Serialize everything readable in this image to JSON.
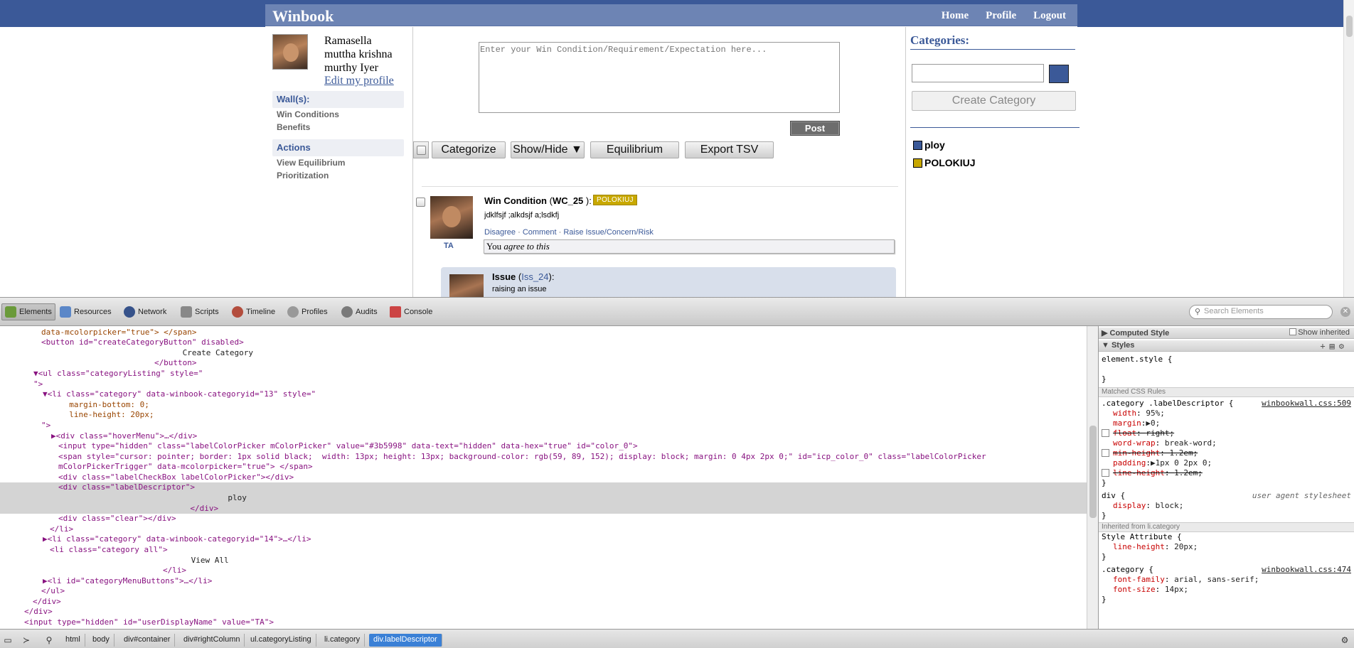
{
  "app": {
    "brand": "Winbook",
    "nav": [
      "Home",
      "Profile",
      "Logout"
    ]
  },
  "user": {
    "name": "Ramasella muttha krishna murthy Iyer",
    "edit_profile": "Edit my profile"
  },
  "left_menu": {
    "walls_header": "Wall(s):",
    "walls": [
      "Win Conditions",
      "Benefits"
    ],
    "actions_header": "Actions",
    "actions": [
      "View Equilibrium",
      "Prioritization"
    ]
  },
  "composer": {
    "placeholder": "Enter your Win Condition/Requirement/Expectation here...",
    "post_label": "Post"
  },
  "toolbar": {
    "buttons": [
      "Categorize",
      "Show/Hide ▼",
      "Equilibrium",
      "Export TSV"
    ]
  },
  "post": {
    "type": "Win Condition",
    "id": "WC_25",
    "badge": "POLOKIUJ",
    "badge_color": "#c8a800",
    "body": "jdklfsjf ;alkdsjf a;lsdkfj",
    "author": "TA",
    "actions": [
      "Disagree",
      "Comment",
      "Raise Issue/Concern/Risk"
    ],
    "agree_prefix": "You",
    "agree_text": "agree to this"
  },
  "issue": {
    "type": "Issue",
    "id": "Iss_24",
    "body": "raising an issue"
  },
  "categories": {
    "title": "Categories:",
    "create_label": "Create Category",
    "picker_color": "#3b5998",
    "items": [
      {
        "label": "ploy",
        "color": "#3b5998"
      },
      {
        "label": "POLOKIUJ",
        "color": "#c8a800"
      }
    ]
  },
  "devtools": {
    "tabs": [
      "Elements",
      "Resources",
      "Network",
      "Scripts",
      "Timeline",
      "Profiles",
      "Audits",
      "Console"
    ],
    "search_placeholder": "Search Elements",
    "computed_style": "Computed Style",
    "show_inherited": "Show inherited",
    "styles": "Styles",
    "matched_rules": "Matched CSS Rules",
    "inherited_from": "Inherited from li.category",
    "breadcrumbs": [
      "html",
      "body",
      "div#container",
      "div#rightColumn",
      "ul.categoryListing",
      "li.category",
      "div.labelDescriptor"
    ],
    "dom_lines": [
      "data-mcolorpicker=\"true\"> </span>",
      "<button id=\"createCategoryButton\" disabled>",
      "                              Create Category",
      "                        </button>",
      "▼<ul class=\"categoryListing\" style=\"",
      "\">",
      "▼<li class=\"category\" data-winbook-categoryid=\"13\" style=\"",
      "  margin-bottom: 0;",
      "  line-height: 20px;",
      "\">",
      "▶<div class=\"hoverMenu\">…</div>",
      "<input type=\"hidden\" class=\"labelColorPicker mColorPicker\" value=\"#3b5998\" data-text=\"hidden\" data-hex=\"true\" id=\"color_0\">",
      "<span style=\"cursor: pointer; border: 1px solid black;  width: 13px; height: 13px; background-color: rgb(59, 89, 152); display: block; margin: 0 4px 2px 0;\" id=\"icp_color_0\" class=\"labelColorPicker",
      "mColorPickerTrigger\" data-mcolorpicker=\"true\"> </span>",
      "<div class=\"labelCheckBox labelColorPicker\"></div>",
      "<div class=\"labelDescriptor\">",
      "                                    ploy",
      "                            </div>",
      "<div class=\"clear\"></div>",
      "</li>",
      "▶<li class=\"category\" data-winbook-categoryid=\"14\">…</li>",
      "<li class=\"category all\">",
      "                              View All",
      "                        </li>",
      "▶<li id=\"categoryMenuButtons\">…</li>",
      "</ul>",
      "</div>",
      "</div>",
      "<input type=\"hidden\" id=\"userDisplayName\" value=\"TA\">"
    ],
    "style_rules": {
      "element_style": "element.style {",
      "close": "}",
      "rule1_selector": ".category .labelDescriptor {",
      "rule1_source": "winbookwall.css:509",
      "rule1_props": [
        [
          "width",
          "95%;"
        ],
        [
          "margin",
          "▶0;"
        ],
        [
          "float",
          "right;"
        ],
        [
          "word-wrap",
          "break-word;"
        ],
        [
          "min-height",
          "1.2em;"
        ],
        [
          "padding",
          "▶1px 0 2px 0;"
        ],
        [
          "line-height",
          "1.2em;"
        ]
      ],
      "div_selector": "div {",
      "div_source": "user agent stylesheet",
      "div_prop": [
        "display",
        "block;"
      ],
      "style_attr": "Style Attribute {",
      "style_attr_prop": [
        "line-height",
        "20px;"
      ],
      "rule2_selector": ".category {",
      "rule2_source": "winbookwall.css:474",
      "rule2_props": [
        [
          "font-family",
          "arial, sans-serif;"
        ],
        [
          "font-size",
          "14px;"
        ]
      ]
    }
  }
}
